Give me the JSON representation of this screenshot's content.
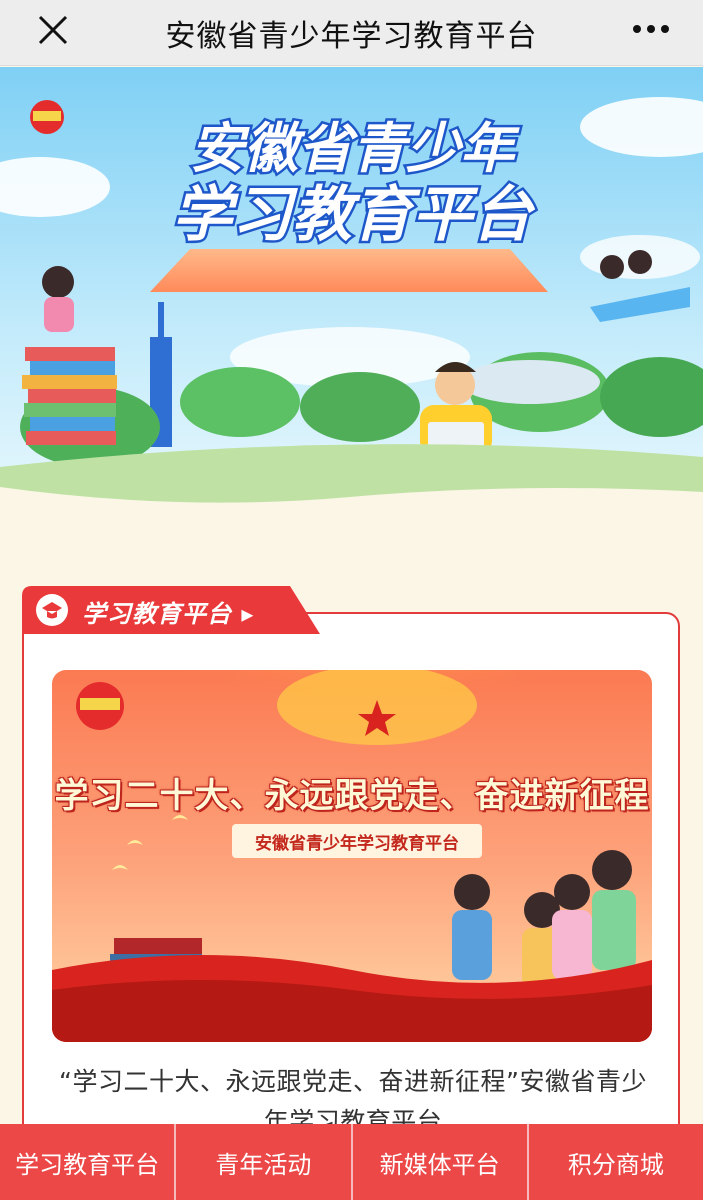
{
  "topbar": {
    "title": "安徽省青少年学习教育平台",
    "close_icon": "close-icon",
    "more_icon": "more-dots-icon"
  },
  "hero": {
    "title_line1": "安徽省青少年",
    "title_line2": "学习教育平台"
  },
  "section": {
    "tab_label": "学习教育平台 ▸",
    "poster": {
      "headline": "学习二十大、永远跟党走、奋进新征程",
      "ribbon": "安徽省青少年学习教育平台"
    },
    "caption": "“学习二十大、永远跟党走、奋进新征程”安徽省青少年学习教育平台"
  },
  "bottom_nav": {
    "items": [
      {
        "label": "学习教育平台"
      },
      {
        "label": "青年活动"
      },
      {
        "label": "新媒体平台"
      },
      {
        "label": "积分商城"
      }
    ]
  },
  "colors": {
    "accent_red": "#ec4848",
    "background": "#fbf6e6",
    "topbar": "#ededed"
  }
}
